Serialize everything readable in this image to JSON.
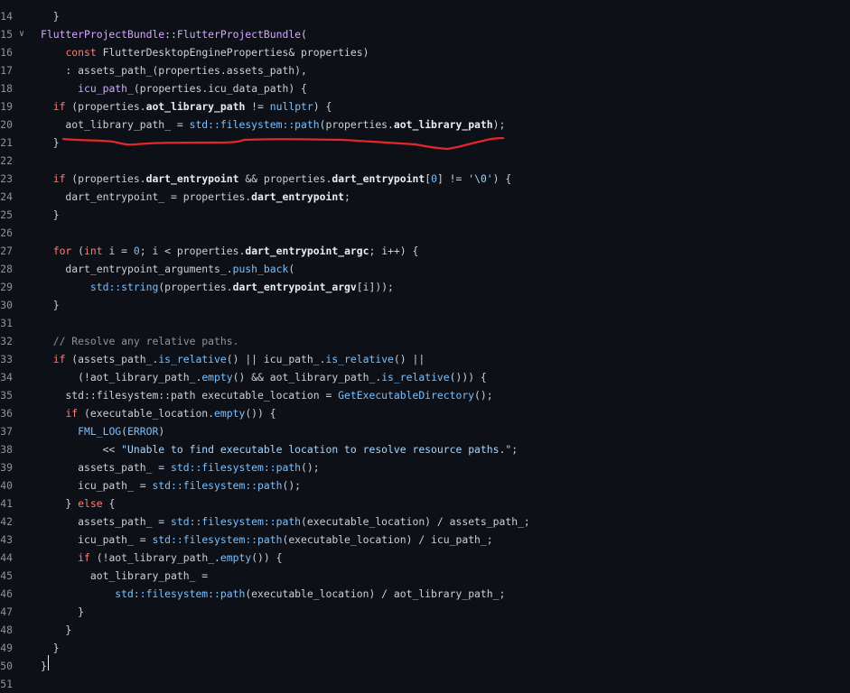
{
  "editor": {
    "first_partial_line": "  }",
    "annotation_color": "#e5262a",
    "lines": [
      {
        "n": "14",
        "tokens": []
      },
      {
        "n": "15",
        "fold": true,
        "tokens": [
          [
            "fn",
            "FlutterProjectBundle"
          ],
          [
            "op",
            "::"
          ],
          [
            "fn",
            "FlutterProjectBundle"
          ],
          [
            "op",
            "("
          ]
        ]
      },
      {
        "n": "16",
        "tokens": [
          [
            "op",
            "    "
          ],
          [
            "kw",
            "const"
          ],
          [
            "op",
            " FlutterDesktopEngineProperties& properties)"
          ]
        ]
      },
      {
        "n": "17",
        "tokens": [
          [
            "op",
            "    : assets_path_(properties."
          ],
          [
            "op",
            "assets_path"
          ],
          [
            "op",
            "),"
          ]
        ]
      },
      {
        "n": "18",
        "tokens": [
          [
            "op",
            "      "
          ],
          [
            "fn",
            "icu_path_"
          ],
          [
            "op",
            "(properties."
          ],
          [
            "op",
            "icu_data_path"
          ],
          [
            "op",
            ") {"
          ]
        ]
      },
      {
        "n": "19",
        "tokens": [
          [
            "op",
            "  "
          ],
          [
            "kw",
            "if"
          ],
          [
            "op",
            " (properties."
          ],
          [
            "mem",
            "aot_library_path"
          ],
          [
            "op",
            " != "
          ],
          [
            "ty",
            "nullptr"
          ],
          [
            "op",
            ") {"
          ]
        ]
      },
      {
        "n": "20",
        "tokens": [
          [
            "op",
            "    aot_library_path_ = "
          ],
          [
            "ty",
            "std::filesystem::path"
          ],
          [
            "op",
            "(properties."
          ],
          [
            "mem",
            "aot_library_path"
          ],
          [
            "op",
            ");"
          ]
        ]
      },
      {
        "n": "21",
        "tokens": [
          [
            "op",
            "  }"
          ]
        ]
      },
      {
        "n": "22",
        "tokens": []
      },
      {
        "n": "23",
        "tokens": [
          [
            "op",
            "  "
          ],
          [
            "kw",
            "if"
          ],
          [
            "op",
            " (properties."
          ],
          [
            "mem",
            "dart_entrypoint"
          ],
          [
            "op",
            " && properties."
          ],
          [
            "mem",
            "dart_entrypoint"
          ],
          [
            "op",
            "["
          ],
          [
            "ty",
            "0"
          ],
          [
            "op",
            "] != "
          ],
          [
            "str",
            "'\\0'"
          ],
          [
            "op",
            ") {"
          ]
        ]
      },
      {
        "n": "24",
        "tokens": [
          [
            "op",
            "    dart_entrypoint_ = properties."
          ],
          [
            "mem",
            "dart_entrypoint"
          ],
          [
            "op",
            ";"
          ]
        ]
      },
      {
        "n": "25",
        "tokens": [
          [
            "op",
            "  }"
          ]
        ]
      },
      {
        "n": "26",
        "tokens": []
      },
      {
        "n": "27",
        "tokens": [
          [
            "op",
            "  "
          ],
          [
            "kw",
            "for"
          ],
          [
            "op",
            " ("
          ],
          [
            "kw",
            "int"
          ],
          [
            "op",
            " i = "
          ],
          [
            "ty",
            "0"
          ],
          [
            "op",
            "; i < properties."
          ],
          [
            "mem",
            "dart_entrypoint_argc"
          ],
          [
            "op",
            "; i++) {"
          ]
        ]
      },
      {
        "n": "28",
        "tokens": [
          [
            "op",
            "    dart_entrypoint_arguments_."
          ],
          [
            "ty",
            "push_back"
          ],
          [
            "op",
            "("
          ]
        ]
      },
      {
        "n": "29",
        "tokens": [
          [
            "op",
            "        "
          ],
          [
            "ty",
            "std::string"
          ],
          [
            "op",
            "(properties."
          ],
          [
            "mem",
            "dart_entrypoint_argv"
          ],
          [
            "op",
            "[i]));"
          ]
        ]
      },
      {
        "n": "30",
        "tokens": [
          [
            "op",
            "  }"
          ]
        ]
      },
      {
        "n": "31",
        "tokens": []
      },
      {
        "n": "32",
        "tokens": [
          [
            "op",
            "  "
          ],
          [
            "cm",
            "// Resolve any relative paths."
          ]
        ]
      },
      {
        "n": "33",
        "tokens": [
          [
            "op",
            "  "
          ],
          [
            "kw",
            "if"
          ],
          [
            "op",
            " (assets_path_."
          ],
          [
            "ty",
            "is_relative"
          ],
          [
            "op",
            "() || icu_path_."
          ],
          [
            "ty",
            "is_relative"
          ],
          [
            "op",
            "() ||"
          ]
        ]
      },
      {
        "n": "34",
        "tokens": [
          [
            "op",
            "      (!aot_library_path_."
          ],
          [
            "ty",
            "empty"
          ],
          [
            "op",
            "() && aot_library_path_."
          ],
          [
            "ty",
            "is_relative"
          ],
          [
            "op",
            "())) {"
          ]
        ]
      },
      {
        "n": "35",
        "tokens": [
          [
            "op",
            "    std::filesystem::path executable_location = "
          ],
          [
            "ty",
            "GetExecutableDirectory"
          ],
          [
            "op",
            "();"
          ]
        ]
      },
      {
        "n": "36",
        "tokens": [
          [
            "op",
            "    "
          ],
          [
            "kw",
            "if"
          ],
          [
            "op",
            " (executable_location."
          ],
          [
            "ty",
            "empty"
          ],
          [
            "op",
            "()) {"
          ]
        ]
      },
      {
        "n": "37",
        "tokens": [
          [
            "op",
            "      "
          ],
          [
            "ty",
            "FML_LOG"
          ],
          [
            "op",
            "("
          ],
          [
            "ty",
            "ERROR"
          ],
          [
            "op",
            ")"
          ]
        ]
      },
      {
        "n": "38",
        "tokens": [
          [
            "op",
            "          << "
          ],
          [
            "str",
            "\"Unable to find executable location to resolve resource paths.\""
          ],
          [
            "op",
            ";"
          ]
        ]
      },
      {
        "n": "39",
        "tokens": [
          [
            "op",
            "      assets_path_ = "
          ],
          [
            "ty",
            "std::filesystem::path"
          ],
          [
            "op",
            "();"
          ]
        ]
      },
      {
        "n": "40",
        "tokens": [
          [
            "op",
            "      icu_path_ = "
          ],
          [
            "ty",
            "std::filesystem::path"
          ],
          [
            "op",
            "();"
          ]
        ]
      },
      {
        "n": "41",
        "tokens": [
          [
            "op",
            "    } "
          ],
          [
            "kw",
            "else"
          ],
          [
            "op",
            " {"
          ]
        ]
      },
      {
        "n": "42",
        "tokens": [
          [
            "op",
            "      assets_path_ = "
          ],
          [
            "ty",
            "std::filesystem::path"
          ],
          [
            "op",
            "(executable_location) / assets_path_;"
          ]
        ]
      },
      {
        "n": "43",
        "tokens": [
          [
            "op",
            "      icu_path_ = "
          ],
          [
            "ty",
            "std::filesystem::path"
          ],
          [
            "op",
            "(executable_location) / icu_path_;"
          ]
        ]
      },
      {
        "n": "44",
        "tokens": [
          [
            "op",
            "      "
          ],
          [
            "kw",
            "if"
          ],
          [
            "op",
            " (!aot_library_path_."
          ],
          [
            "ty",
            "empty"
          ],
          [
            "op",
            "()) {"
          ]
        ]
      },
      {
        "n": "45",
        "tokens": [
          [
            "op",
            "        aot_library_path_ ="
          ]
        ]
      },
      {
        "n": "46",
        "tokens": [
          [
            "op",
            "            "
          ],
          [
            "ty",
            "std::filesystem::path"
          ],
          [
            "op",
            "(executable_location) / aot_library_path_;"
          ]
        ]
      },
      {
        "n": "47",
        "tokens": [
          [
            "op",
            "      }"
          ]
        ]
      },
      {
        "n": "48",
        "tokens": [
          [
            "op",
            "    }"
          ]
        ]
      },
      {
        "n": "49",
        "tokens": [
          [
            "op",
            "  }"
          ]
        ]
      },
      {
        "n": "50",
        "tokens": [
          [
            "op",
            "}"
          ]
        ]
      },
      {
        "n": "51",
        "tokens": []
      }
    ]
  }
}
